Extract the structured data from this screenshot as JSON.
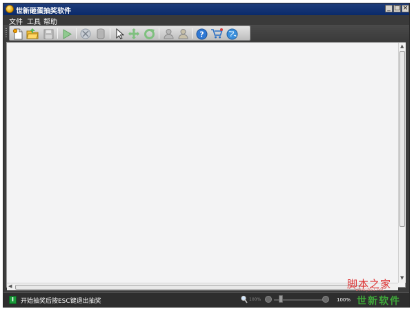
{
  "window": {
    "title": "世新砸蛋抽奖软件",
    "controls": {
      "minimize": "_",
      "maximize": "□",
      "close": "×"
    }
  },
  "menubar": {
    "items": [
      {
        "label": "文件"
      },
      {
        "label": "工具"
      },
      {
        "label": "帮助"
      }
    ]
  },
  "toolbar": {
    "buttons": [
      {
        "icon": "new-file-icon"
      },
      {
        "icon": "open-folder-icon"
      },
      {
        "icon": "save-disk-icon"
      },
      {
        "icon": "play-icon"
      },
      {
        "icon": "scissors-icon"
      },
      {
        "icon": "database-icon"
      },
      {
        "icon": "cursor-icon"
      },
      {
        "icon": "move-icon"
      },
      {
        "icon": "rotate-icon"
      },
      {
        "icon": "user-icon"
      },
      {
        "icon": "users-icon"
      },
      {
        "icon": "help-icon"
      },
      {
        "icon": "cart-icon"
      },
      {
        "icon": "globe-icon"
      }
    ]
  },
  "watermark": {
    "top": "脚本之家",
    "url": "www.jb51.net",
    "brand": "世新软件"
  },
  "statusbar": {
    "message": "开始抽奖后按ESC键退出抽奖",
    "zoom_label": "100%",
    "zoom_level_fraction": 0.1,
    "zoom_percent": "100%"
  },
  "colors": {
    "titlebar": "#0a2a6b",
    "chrome": "#3a3a3a",
    "canvas": "#f3f3f4",
    "status_icon": "#1a9b3a",
    "watermark_red": "#dd3333",
    "watermark_green": "#3fa83a"
  }
}
